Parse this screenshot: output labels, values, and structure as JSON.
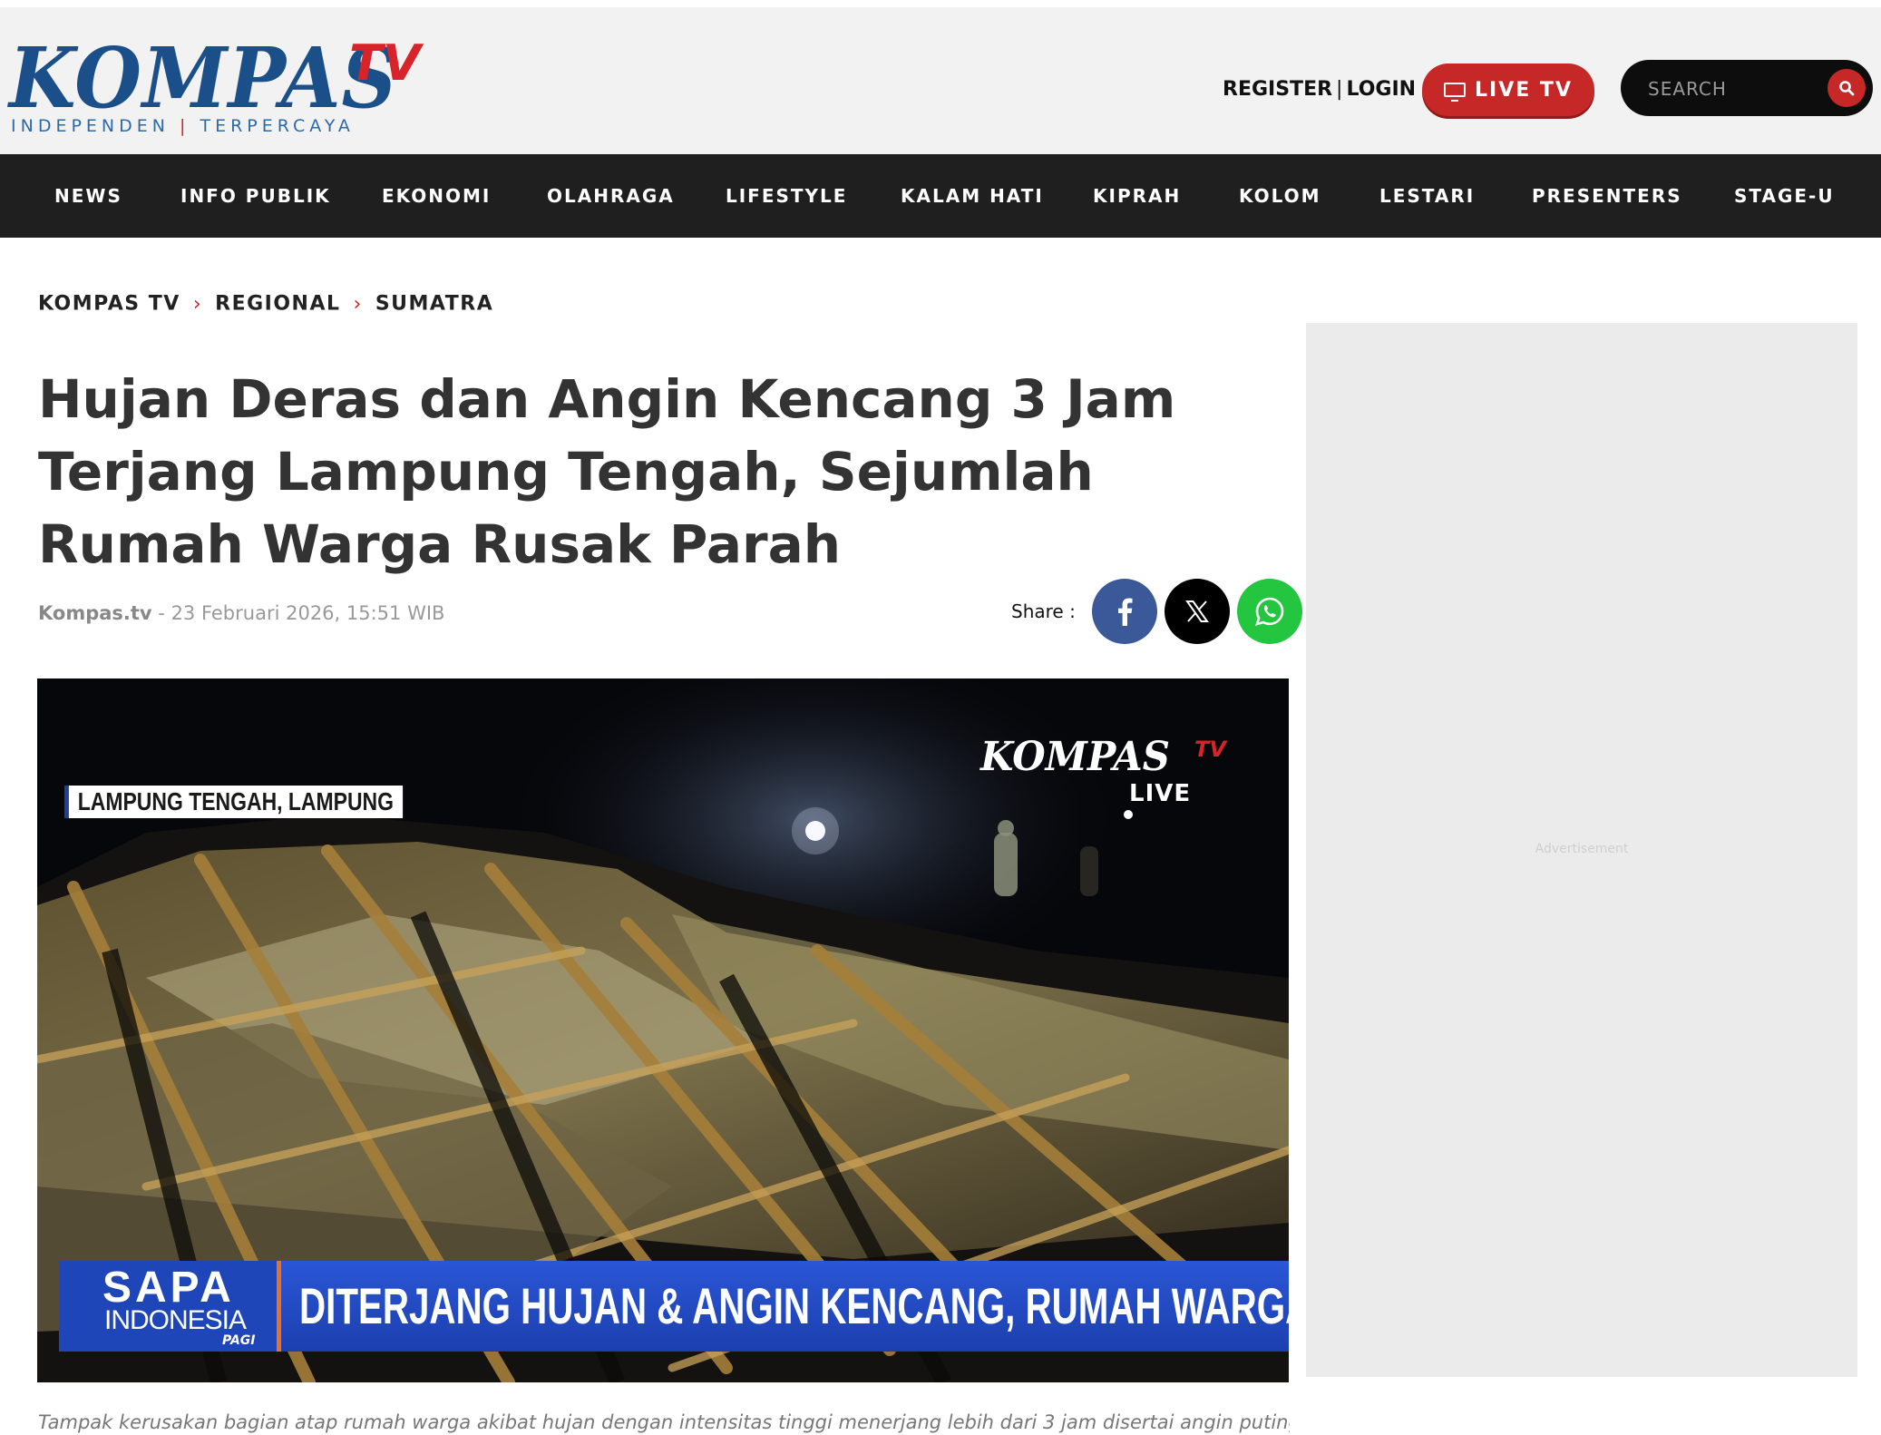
{
  "header": {
    "logo_text": "KOMPAS",
    "logo_suffix": "TV",
    "tagline_left": "INDEPENDEN",
    "tagline_sep": "|",
    "tagline_right": "TERPERCAYA",
    "register_label": "REGISTER",
    "divider": "|",
    "login_label": "LOGIN",
    "live_tv_label": "LIVE TV",
    "search_placeholder": "SEARCH"
  },
  "nav": {
    "items": [
      "NEWS",
      "INFO PUBLIK",
      "EKONOMI",
      "OLAHRAGA",
      "LIFESTYLE",
      "KALAM HATI",
      "KIPRAH",
      "KOLOM",
      "LESTARI",
      "PRESENTERS",
      "STAGE-U"
    ]
  },
  "breadcrumb": [
    "KOMPAS TV",
    "REGIONAL",
    "SUMATRA"
  ],
  "article": {
    "title": "Hujan Deras dan Angin Kencang 3 Jam Terjang Lampung Tengah, Sejumlah Rumah Warga Rusak Parah",
    "source": "Kompas.tv",
    "date_sep": " - ",
    "date": "23 Februari 2026, 15:51 WIB",
    "share_label": "Share :",
    "image": {
      "location_label": "LAMPUNG TENGAH, LAMPUNG",
      "watermark_main": "KOMPAS",
      "watermark_tv": "TV",
      "watermark_live": "LIVE",
      "program_line1": "SAPA",
      "program_line2": "INDONESIA",
      "program_line3": "PAGI",
      "ticker": "DITERJANG HUJAN & ANGIN KENCANG, RUMAH WARGA ROBOH"
    },
    "caption": "Tampak kerusakan bagian atap rumah warga akibat hujan dengan intensitas tinggi menerjang lebih dari 3 jam disertai angin puting beliung di"
  },
  "sidebar": {
    "ad_label": "Advertisement"
  },
  "colors": {
    "brand_blue": "#1b4f8a",
    "brand_red": "#c62828",
    "nav_bg": "#1f1f1f",
    "facebook": "#3b5998",
    "whatsapp": "#25c63f"
  }
}
